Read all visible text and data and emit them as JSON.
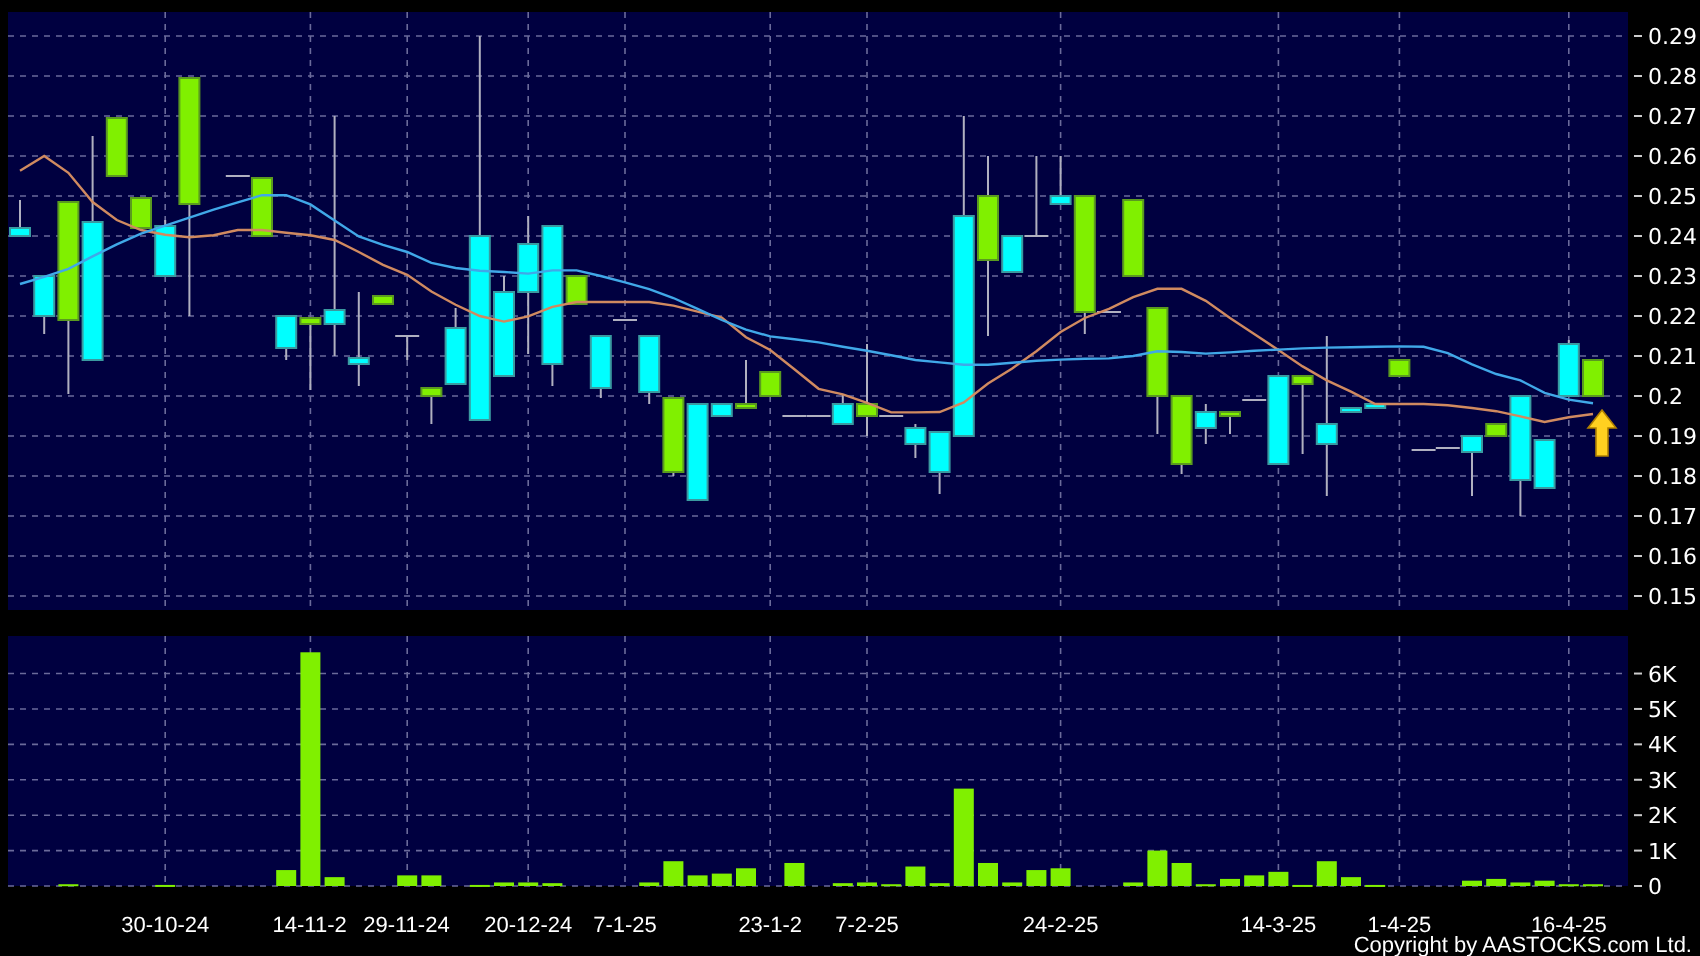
{
  "price_panel": {
    "chart_data": {
      "type": "candlestick",
      "grid": true,
      "ylim": [
        0.1465,
        0.296
      ],
      "ohlc": [
        [
          0.24,
          0.249,
          0.24,
          0.242
        ],
        [
          0.22,
          0.23,
          0.2155,
          0.23
        ],
        [
          0.2485,
          0.2485,
          0.2005,
          0.219
        ],
        [
          0.209,
          0.265,
          0.209,
          0.2435
        ],
        [
          0.2695,
          0.2695,
          0.255,
          0.255
        ],
        [
          0.2495,
          0.2495,
          0.242,
          0.242
        ],
        [
          0.23,
          0.244,
          0.23,
          0.2425
        ],
        [
          0.2795,
          0.2795,
          0.22,
          0.248
        ],
        null,
        [
          0.255,
          0.255,
          0.255,
          0.255
        ],
        [
          0.2545,
          0.2545,
          0.24,
          0.24
        ],
        [
          0.212,
          0.22,
          0.209,
          0.22
        ],
        [
          0.2195,
          0.2195,
          0.2015,
          0.218
        ],
        [
          0.218,
          0.27,
          0.21,
          0.2215
        ],
        [
          0.208,
          0.226,
          0.2025,
          0.2095
        ],
        [
          0.225,
          0.225,
          0.223,
          0.223
        ],
        [
          0.215,
          0.215,
          0.209,
          0.215
        ],
        [
          0.202,
          0.202,
          0.193,
          0.2
        ],
        [
          0.203,
          0.222,
          0.203,
          0.217
        ],
        [
          0.194,
          0.29,
          0.194,
          0.24
        ],
        [
          0.205,
          0.23,
          0.205,
          0.226
        ],
        [
          0.226,
          0.245,
          0.2105,
          0.238
        ],
        [
          0.208,
          0.2425,
          0.2025,
          0.2425
        ],
        [
          0.23,
          0.23,
          0.223,
          0.223
        ],
        [
          0.202,
          0.215,
          0.1995,
          0.215
        ],
        [
          0.219,
          0.219,
          0.219,
          0.219
        ],
        [
          0.201,
          0.215,
          0.198,
          0.215
        ],
        [
          0.1995,
          0.1995,
          0.18,
          0.181
        ],
        [
          0.174,
          0.198,
          0.174,
          0.198
        ],
        [
          0.195,
          0.198,
          0.195,
          0.198
        ],
        [
          0.198,
          0.209,
          0.197,
          0.197
        ],
        [
          0.206,
          0.206,
          0.2,
          0.2
        ],
        [
          0.195,
          0.195,
          0.195,
          0.195
        ],
        [
          0.195,
          0.195,
          0.195,
          0.195
        ],
        [
          0.193,
          0.2005,
          0.193,
          0.198
        ],
        [
          0.198,
          0.213,
          0.19,
          0.195
        ],
        [
          0.195,
          0.195,
          0.195,
          0.195
        ],
        [
          0.188,
          0.193,
          0.1845,
          0.192
        ],
        [
          0.181,
          0.191,
          0.1755,
          0.191
        ],
        [
          0.19,
          0.27,
          0.19,
          0.245
        ],
        [
          0.25,
          0.26,
          0.215,
          0.234
        ],
        [
          0.231,
          0.24,
          0.231,
          0.24
        ],
        [
          0.24,
          0.26,
          0.24,
          0.24
        ],
        [
          0.248,
          0.26,
          0.248,
          0.25
        ],
        [
          0.25,
          0.25,
          0.2155,
          0.221
        ],
        [
          0.221,
          0.221,
          0.221,
          0.221
        ],
        [
          0.249,
          0.249,
          0.23,
          0.23
        ],
        [
          0.222,
          0.222,
          0.1905,
          0.2
        ],
        [
          0.2,
          0.2,
          0.1805,
          0.183
        ],
        [
          0.192,
          0.198,
          0.188,
          0.196
        ],
        [
          0.196,
          0.196,
          0.1905,
          0.195
        ],
        [
          0.199,
          0.199,
          0.199,
          0.199
        ],
        [
          0.183,
          0.205,
          0.183,
          0.205
        ],
        [
          0.205,
          0.205,
          0.1855,
          0.203
        ],
        [
          0.188,
          0.215,
          0.175,
          0.193
        ],
        [
          0.196,
          0.197,
          0.196,
          0.197
        ],
        [
          0.197,
          0.198,
          0.197,
          0.198
        ],
        [
          0.209,
          0.209,
          0.205,
          0.205
        ],
        [
          0.1865,
          0.1865,
          0.1865,
          0.1865
        ],
        [
          0.187,
          0.187,
          0.187,
          0.187
        ],
        [
          0.186,
          0.19,
          0.175,
          0.19
        ],
        [
          0.193,
          0.193,
          0.19,
          0.19
        ],
        [
          0.179,
          0.2,
          0.17,
          0.2
        ],
        [
          0.177,
          0.189,
          0.177,
          0.189
        ],
        [
          0.2,
          0.214,
          0.2,
          0.213
        ],
        [
          0.209,
          0.209,
          0.2,
          0.2
        ]
      ],
      "yticks": [
        0.29,
        0.28,
        0.27,
        0.26,
        0.25,
        0.24,
        0.23,
        0.22,
        0.21,
        {
          "value": 0.2,
          "label": "0.2"
        },
        0.19,
        0.18,
        0.17,
        0.16,
        0.15
      ]
    }
  },
  "moving_averages": {
    "chart_data": {
      "type": "line",
      "ylim": [
        0.1465,
        0.296
      ],
      "series": [
        {
          "color": "#d08a60",
          "values": [
            0.2563,
            0.26,
            0.2558,
            0.2485,
            0.244,
            0.2415,
            0.2403,
            0.2397,
            0.2402,
            0.2415,
            0.2415,
            0.2408,
            0.2402,
            0.239,
            0.236,
            0.2328,
            0.2303,
            0.2261,
            0.2228,
            0.22,
            0.2186,
            0.2199,
            0.2223,
            0.2235,
            0.2235,
            0.2235,
            0.2235,
            0.2226,
            0.2211,
            0.2196,
            0.2147,
            0.2115,
            0.2067,
            0.2018,
            0.2004,
            0.1983,
            0.1959,
            0.1959,
            0.196,
            0.1984,
            0.2031,
            0.2069,
            0.2112,
            0.216,
            0.2195,
            0.2218,
            0.2247,
            0.2268,
            0.2268,
            0.2238,
            0.2195,
            0.2155,
            0.2115,
            0.2074,
            0.2039,
            0.2011,
            0.198,
            0.198,
            0.198,
            0.1977,
            0.197,
            0.1962,
            0.1949,
            0.1935,
            0.1947,
            0.1955
          ]
        },
        {
          "color": "#40a8e8",
          "values": [
            0.228,
            0.2298,
            0.2318,
            0.2349,
            0.2379,
            0.2406,
            0.2426,
            0.2446,
            0.2466,
            0.2484,
            0.2502,
            0.2502,
            0.2479,
            0.2439,
            0.2399,
            0.2378,
            0.236,
            0.2333,
            0.232,
            0.2313,
            0.231,
            0.2306,
            0.2314,
            0.2314,
            0.23,
            0.2284,
            0.2267,
            0.2245,
            0.2218,
            0.219,
            0.2166,
            0.2149,
            0.2142,
            0.2134,
            0.2123,
            0.2113,
            0.2102,
            0.209,
            0.2084,
            0.2078,
            0.2078,
            0.2083,
            0.2088,
            0.2091,
            0.2093,
            0.2094,
            0.21,
            0.2112,
            0.211,
            0.2106,
            0.2109,
            0.2113,
            0.2116,
            0.2119,
            0.2121,
            0.2122,
            0.2123,
            0.2124,
            0.2123,
            0.2107,
            0.2079,
            0.2055,
            0.2039,
            0.2008,
            0.1991,
            0.1982
          ]
        }
      ]
    }
  },
  "volume_panel": {
    "chart_data": {
      "type": "bar",
      "grid": true,
      "ylim": [
        0,
        7060
      ],
      "categories": [
        null,
        null,
        null,
        null,
        null,
        null,
        "30-10-24",
        null,
        null,
        null,
        null,
        null,
        "14-11-2",
        null,
        null,
        null,
        "29-11-24",
        null,
        null,
        null,
        null,
        "20-12-24",
        null,
        null,
        null,
        "7-1-25",
        null,
        null,
        null,
        null,
        null,
        "23-1-2",
        null,
        null,
        null,
        "7-2-25",
        null,
        null,
        null,
        null,
        null,
        null,
        null,
        "24-2-25",
        null,
        null,
        null,
        null,
        null,
        null,
        null,
        null,
        "14-3-25",
        null,
        null,
        null,
        null,
        "1-4-25",
        null,
        null,
        null,
        null,
        null,
        null,
        "16-4-25",
        null
      ],
      "values": [
        0,
        0,
        50,
        0,
        0,
        0,
        30,
        0,
        0,
        0,
        0,
        450,
        6600,
        250,
        0,
        0,
        300,
        300,
        0,
        30,
        100,
        100,
        80,
        0,
        0,
        0,
        100,
        700,
        300,
        350,
        500,
        0,
        650,
        0,
        80,
        100,
        50,
        550,
        80,
        2750,
        650,
        100,
        450,
        500,
        0,
        0,
        100,
        1000,
        650,
        50,
        200,
        300,
        400,
        30,
        700,
        250,
        30,
        0,
        0,
        0,
        150,
        200,
        100,
        150,
        50,
        50
      ],
      "yticks": [
        {
          "value": 0,
          "label": "0"
        },
        {
          "value": 1000,
          "label": "1K"
        },
        {
          "value": 2000,
          "label": "2K"
        },
        {
          "value": 3000,
          "label": "3K"
        },
        {
          "value": 4000,
          "label": "4K"
        },
        {
          "value": 5000,
          "label": "5K"
        },
        {
          "value": 6000,
          "label": "6K"
        }
      ]
    }
  },
  "copyright": "Copyright by AASTOCKS.com Ltd."
}
